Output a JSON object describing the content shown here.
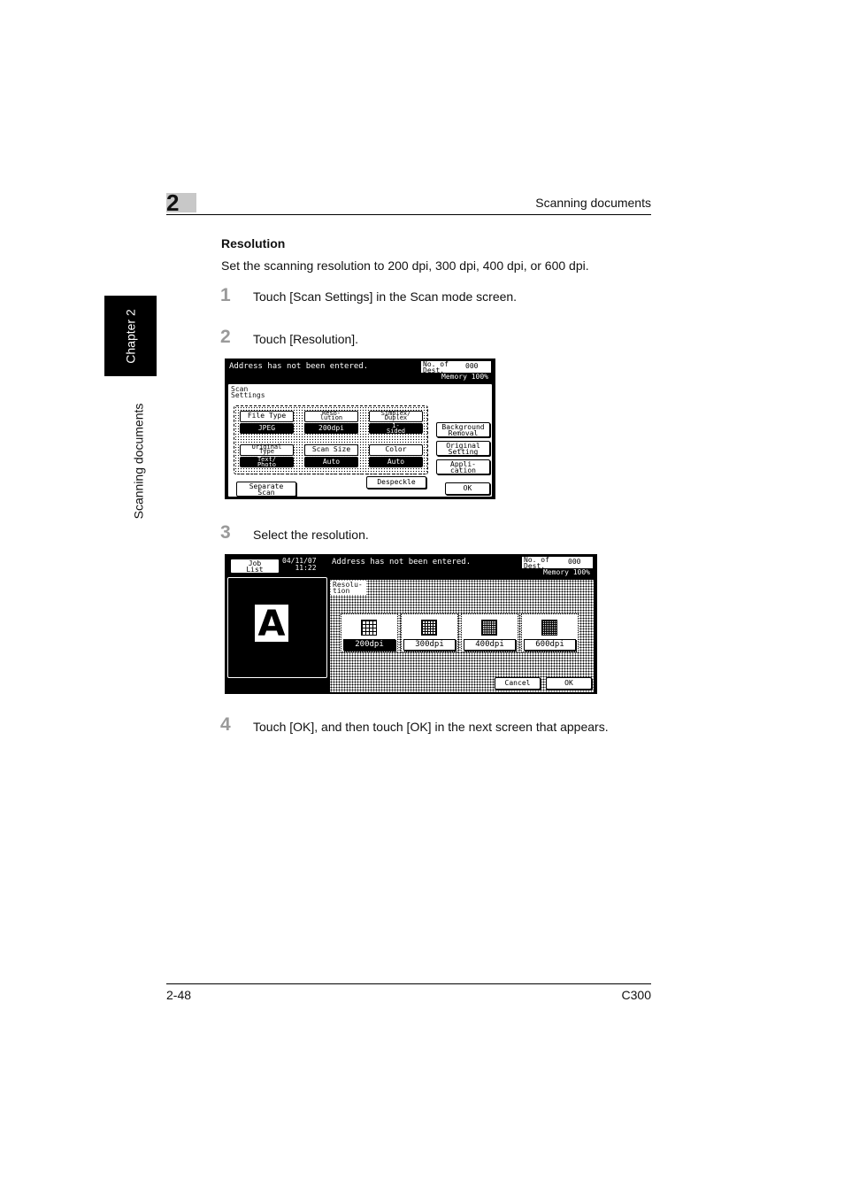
{
  "header": {
    "chapter_number": "2",
    "section_title": "Scanning documents"
  },
  "side_tab": {
    "chapter": "Chapter 2",
    "section": "Scanning documents"
  },
  "heading": "Resolution",
  "intro": "Set the scanning resolution to 200 dpi, 300 dpi, 400 dpi, or 600 dpi.",
  "steps": [
    {
      "num": "1",
      "text": "Touch [Scan Settings] in the Scan mode screen."
    },
    {
      "num": "2",
      "text": "Touch [Resolution]."
    },
    {
      "num": "3",
      "text": "Select the resolution."
    },
    {
      "num": "4",
      "text": "Touch [OK], and then touch [OK] in the next screen that appears."
    }
  ],
  "screen1": {
    "message": "Address has not been entered.",
    "dest_label": "No. of\nDest.",
    "dest_count": "000",
    "memory": "Memory 100%",
    "panel_title": "Scan\nSettings",
    "settings": [
      {
        "label": "File Type",
        "value": "JPEG"
      },
      {
        "label": "Reso-\nlution",
        "value": "200dpi"
      },
      {
        "label": "Simplex/\nDuplex",
        "value": "1-\nSided"
      },
      {
        "label": "Original\nType",
        "value": "Text/\nPhoto"
      },
      {
        "label": "Scan Size",
        "value": "Auto"
      },
      {
        "label": "Color",
        "value": "Auto"
      }
    ],
    "side_buttons": [
      "Background\nRemoval",
      "Original\nSetting",
      "Appli-\ncation"
    ],
    "despeckle": "Despeckle",
    "separate_scan": "Separate\nScan",
    "ok": "OK"
  },
  "screen2": {
    "job_list": "Job\nList",
    "datetime": "04/11/07\n11:22",
    "preview_letter": "A",
    "message": "Address has not been entered.",
    "dest_label": "No. of\nDest.",
    "dest_count": "000",
    "memory": "Memory 100%",
    "panel_title": "Resolu-\ntion",
    "options": [
      "200dpi",
      "300dpi",
      "400dpi",
      "600dpi"
    ],
    "selected": "200dpi",
    "cancel": "Cancel",
    "ok": "OK"
  },
  "footer": {
    "page": "2-48",
    "model": "C300"
  }
}
